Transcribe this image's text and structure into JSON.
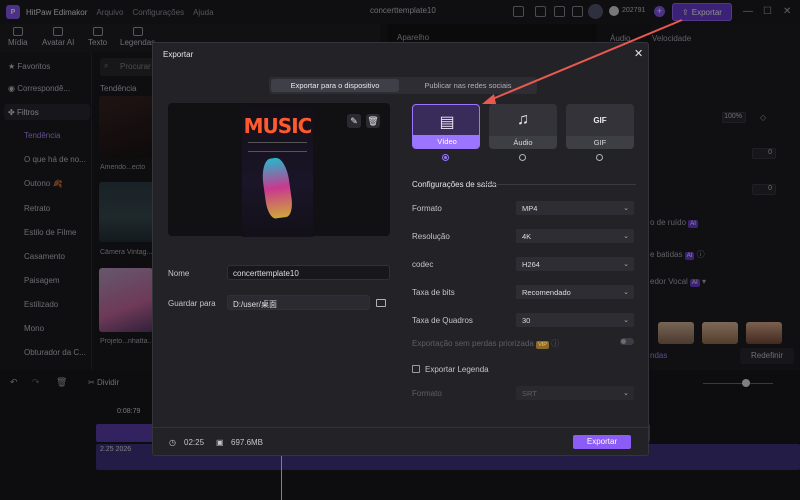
{
  "app": {
    "name": "HitPaw Edimakor",
    "logo_text": "P",
    "menu": [
      "Arquivo",
      "Configurações",
      "Ajuda"
    ],
    "project_title": "concerttemplate10",
    "credits": "202791",
    "export_label": "Exportar"
  },
  "toolbar": {
    "items": [
      "Mídia",
      "Avatar AI",
      "Texto",
      "Legendas"
    ]
  },
  "sidebar": {
    "favorites": "Favoritos",
    "correspond": "Correspondê...",
    "filters": "Filtros",
    "items": [
      "Tendência",
      "O que há de no...",
      "Outono 🍂",
      "Retrato",
      "Estilo de Filme",
      "Casamento",
      "Paisagem",
      "Estilizado",
      "Mono",
      "Obturador da C..."
    ]
  },
  "media": {
    "search_placeholder": "Procurar",
    "section": "Tendência",
    "thumbs": [
      "Amendo...ecto",
      "Câmera Vintag...",
      "Projeto...nhatta..."
    ]
  },
  "right_panel": {
    "tabs": [
      "Aparelho",
      "Áudio",
      "Velocidade"
    ],
    "zoom": "100%",
    "val1": "0",
    "val2": "0",
    "noise": "o de ruído",
    "beats": "e batidas",
    "vocal": "edor Vocal",
    "ai": "AI",
    "redefine": "Redefinir",
    "pendas": "ndas"
  },
  "timeline": {
    "split": "Dividir",
    "timecode": "0:08:79",
    "clip": "2.25 2026"
  },
  "modal": {
    "title": "Exportar",
    "tabs": {
      "device": "Exportar para o dispositivo",
      "social": "Publicar nas redes sociais"
    },
    "poster_title": "MUSIC",
    "name_label": "Nome",
    "name_value": "concerttemplate10",
    "save_label": "Guardar para",
    "save_value": "D:/user/桌面",
    "formats": [
      {
        "label": "Vídeo",
        "icon": "film-icon",
        "selected": true
      },
      {
        "label": "Áudio",
        "icon": "music-note-icon",
        "selected": false
      },
      {
        "label": "GIF",
        "icon": "gif-icon",
        "selected": false
      }
    ],
    "gif_glyph": "GIF",
    "output_section": "Configurações de saída",
    "settings": [
      {
        "label": "Formato",
        "value": "MP4"
      },
      {
        "label": "Resolução",
        "value": "4K"
      },
      {
        "label": "codec",
        "value": "H264"
      },
      {
        "label": "Taxa de bits",
        "value": "Recomendado"
      },
      {
        "label": "Taxa de Quadros",
        "value": "30"
      }
    ],
    "lossless_label": "Exportação sem perdas priorizada",
    "vip": "VIP",
    "subtitle_label": "Exportar Legenda",
    "subtitle_format_label": "Formato",
    "subtitle_format_value": "SRT",
    "duration": "02:25",
    "size": "697.6MB",
    "export_button": "Exportar"
  },
  "colors": {
    "accent": "#8b5cf6",
    "arrow": "#e85a4f"
  }
}
